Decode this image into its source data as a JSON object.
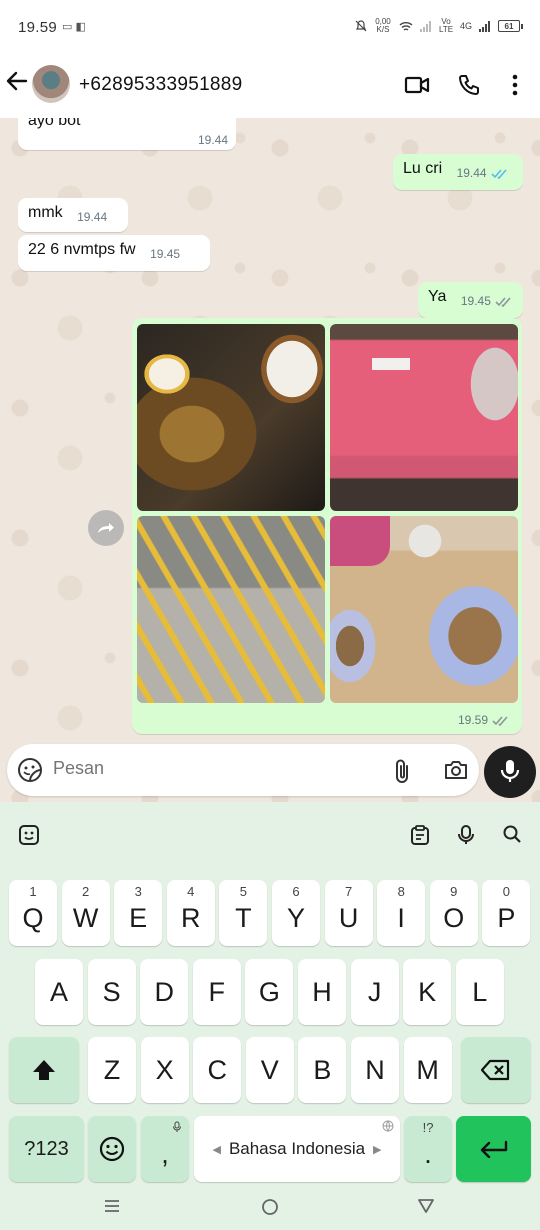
{
  "status_bar": {
    "time": "19.59",
    "left_icons": "▭ ◧",
    "net_speed": "0,00 K/S",
    "net_type": "Vo LTE",
    "net_gen": "4G",
    "battery": "61"
  },
  "header": {
    "contact_name": "+62895333951889"
  },
  "messages": [
    {
      "dir": "in",
      "text": "ayo bot",
      "time": "19.44"
    },
    {
      "dir": "out",
      "text": "Lu cri",
      "time": "19.44",
      "read": true
    },
    {
      "dir": "in",
      "text": "mmk",
      "time": "19.44"
    },
    {
      "dir": "in",
      "text": "22 6 nvmtps fw",
      "time": "19.45"
    },
    {
      "dir": "out",
      "text": "Ya",
      "time": "19.45",
      "read": false
    }
  ],
  "album": {
    "time": "19.59",
    "photos": [
      "noodles-and-rice-photo",
      "pink-drink-photo",
      "french-fries-photo",
      "fried-rice-plates-photo"
    ]
  },
  "composer": {
    "placeholder": "Pesan"
  },
  "keyboard": {
    "row1": [
      {
        "letter": "Q",
        "hint": "1"
      },
      {
        "letter": "W",
        "hint": "2"
      },
      {
        "letter": "E",
        "hint": "3"
      },
      {
        "letter": "R",
        "hint": "4"
      },
      {
        "letter": "T",
        "hint": "5"
      },
      {
        "letter": "Y",
        "hint": "6"
      },
      {
        "letter": "U",
        "hint": "7"
      },
      {
        "letter": "I",
        "hint": "8"
      },
      {
        "letter": "O",
        "hint": "9"
      },
      {
        "letter": "P",
        "hint": "0"
      }
    ],
    "row2": [
      "A",
      "S",
      "D",
      "F",
      "G",
      "H",
      "J",
      "K",
      "L"
    ],
    "row3": [
      "Z",
      "X",
      "C",
      "V",
      "B",
      "N",
      "M"
    ],
    "symbols_key": "?123",
    "comma_key": ",",
    "period_key": ".",
    "period_hint": "!?",
    "space_label": "Bahasa Indonesia"
  },
  "colors": {
    "outgoing_bubble": "#d9fdd3",
    "incoming_bubble": "#ffffff",
    "chat_bg": "#efe7de",
    "read_tick": "#53bdeb",
    "enter_key": "#21c35d",
    "keyboard_bg": "#e4f1e5"
  }
}
